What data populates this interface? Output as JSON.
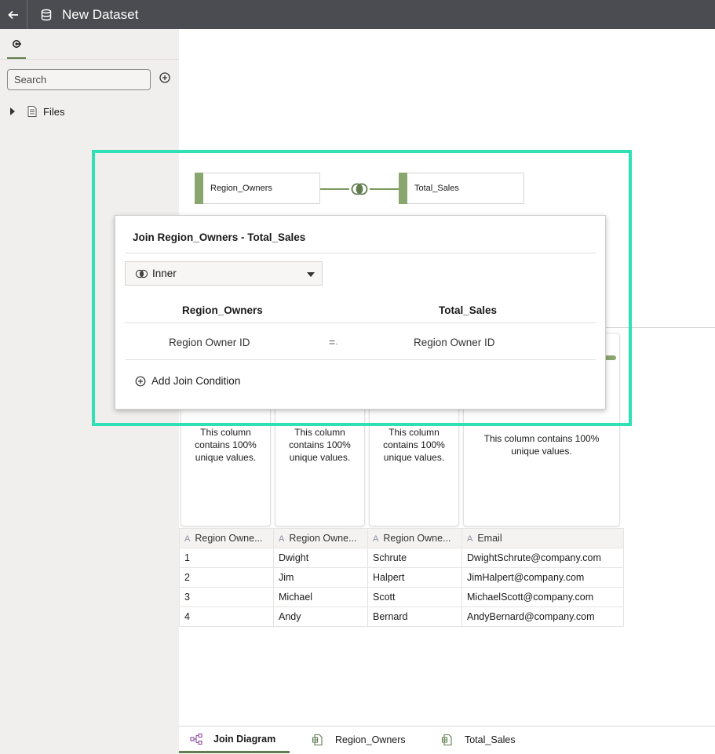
{
  "header": {
    "title": "New Dataset"
  },
  "sidebar": {
    "search_placeholder": "Search",
    "tree": [
      {
        "label": "Files"
      }
    ]
  },
  "diagram": {
    "left_node": "Region_Owners",
    "right_node": "Total_Sales"
  },
  "join_popup": {
    "title": "Join Region_Owners - Total_Sales",
    "join_type": "Inner",
    "left_header": "Region_Owners",
    "right_header": "Total_Sales",
    "conditions": [
      {
        "left": "Region Owner ID",
        "operator": "=",
        "right": "Region Owner ID"
      }
    ],
    "add_condition_label": "Add Join Condition"
  },
  "profile_cards": [
    {
      "message": "This column contains 100% unique values."
    },
    {
      "message": "This column contains 100% unique values."
    },
    {
      "message": "This column contains 100% unique values."
    },
    {
      "message": "This column contains 100% unique values."
    }
  ],
  "table": {
    "type_marker": "A",
    "headers": [
      "Region Owne...",
      "Region Owne...",
      "Region Owne...",
      "Email"
    ],
    "rows": [
      [
        "1",
        "Dwight",
        "Schrute",
        "DwightSchrute@company.com"
      ],
      [
        "2",
        "Jim",
        "Halpert",
        "JimHalpert@company.com"
      ],
      [
        "3",
        "Michael",
        "Scott",
        "MichaelScott@company.com"
      ],
      [
        "4",
        "Andy",
        "Bernard",
        "AndyBernard@company.com"
      ]
    ]
  },
  "bottom_tabs": [
    {
      "label": "Join Diagram",
      "icon": "join-diagram-icon"
    },
    {
      "label": "Region_Owners",
      "icon": "table-file-icon"
    },
    {
      "label": "Total_Sales",
      "icon": "table-file-icon"
    }
  ],
  "colors": {
    "accent": "#5f7d4f",
    "node_bar": "#8aa66f",
    "highlight": "#2ee0b4",
    "topbar": "#4a4c52"
  }
}
